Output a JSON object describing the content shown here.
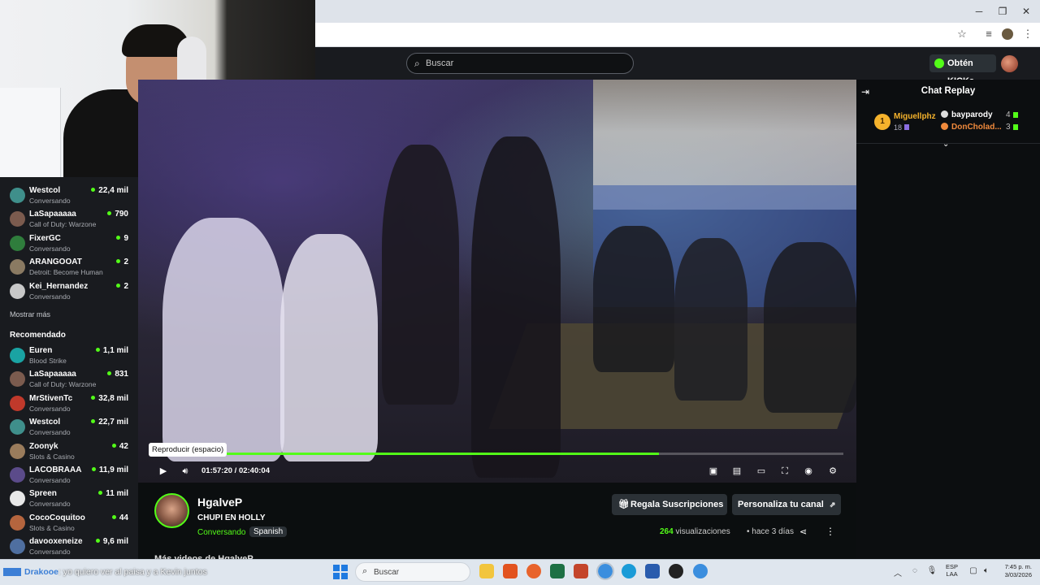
{
  "browser": {
    "window_controls": [
      "minimize",
      "restore",
      "close"
    ],
    "address_icons": [
      "star-icon",
      "media-icon",
      "profile-icon",
      "menu-icon"
    ]
  },
  "header": {
    "search_placeholder": "Buscar",
    "kicks_label": "Obtén KICKs"
  },
  "sidebar": {
    "following": [
      {
        "name": "Westcol",
        "sub": "Conversando",
        "count": "22,4 mil",
        "color": "#3f8f8b"
      },
      {
        "name": "LaSapaaaaa",
        "sub": "Call of Duty: Warzone",
        "count": "790",
        "color": "#7b5b4e"
      },
      {
        "name": "FixerGC",
        "sub": "Conversando",
        "count": "9",
        "color": "#2f7d3c"
      },
      {
        "name": "ARANGOOAT",
        "sub": "Detroit: Become Human",
        "count": "2",
        "color": "#8a7a62"
      },
      {
        "name": "Kei_Hernandez",
        "sub": "Conversando",
        "count": "2",
        "color": "#c8c8c8"
      }
    ],
    "more_label": "Mostrar más",
    "recommended_title": "Recomendado",
    "recommended": [
      {
        "name": "Euren",
        "sub": "Blood Strike",
        "count": "1,1 mil",
        "color": "#1aa3a3"
      },
      {
        "name": "LaSapaaaaa",
        "sub": "Call of Duty: Warzone",
        "count": "831",
        "color": "#7b5b4e"
      },
      {
        "name": "MrStivenTc",
        "sub": "Conversando",
        "count": "32,8 mil",
        "color": "#c0392b"
      },
      {
        "name": "Westcol",
        "sub": "Conversando",
        "count": "22,7 mil",
        "color": "#3f8f8b"
      },
      {
        "name": "Zoonyk",
        "sub": "Slots & Casino",
        "count": "42",
        "color": "#9a7c5c"
      },
      {
        "name": "LACOBRAAA",
        "sub": "Conversando",
        "count": "11,9 mil",
        "color": "#5b4b8a"
      },
      {
        "name": "Spreen",
        "sub": "Conversando",
        "count": "11 mil",
        "color": "#e8e8e8"
      },
      {
        "name": "CocoCoquitoo",
        "sub": "Slots & Casino",
        "count": "44",
        "color": "#b5653e"
      },
      {
        "name": "davooxeneize",
        "sub": "Conversando",
        "count": "9,6 mil",
        "color": "#4f6fa0"
      }
    ]
  },
  "video": {
    "tooltip": "Reproducir (espacio)",
    "time": "01:57:20 / 02:40:04",
    "progress": 0.733
  },
  "chat": {
    "title": "Chat Replay",
    "top_gifter": {
      "rank": "1",
      "name": "Miguellphz",
      "count": "18"
    },
    "gifters": [
      {
        "name": "bayparody",
        "count": "4",
        "color": "#ffffff"
      },
      {
        "name": "DonCholad...",
        "count": "3",
        "color": "#f08a3c"
      }
    ]
  },
  "stream": {
    "streamer": "HgalveP",
    "title": "CHUPI EN HOLLY",
    "category": "Conversando",
    "language": "Spanish",
    "gift_subs_label": "Regala Suscripciones",
    "customize_label": "Personaliza tu canal",
    "views_count": "264",
    "views_label": "visualizaciones",
    "ago": "hace 3 días",
    "more_videos": "Más videos de HgalveP"
  },
  "ticker": {
    "user": "Drakooe",
    "message": ": yo quiero ver al paisa y a Kevin juntos"
  },
  "taskbar": {
    "search_placeholder": "Buscar",
    "lang_top": "ESP",
    "lang_bottom": "LAA",
    "time": "7:45 p. m.",
    "date": "3/03/2026"
  }
}
